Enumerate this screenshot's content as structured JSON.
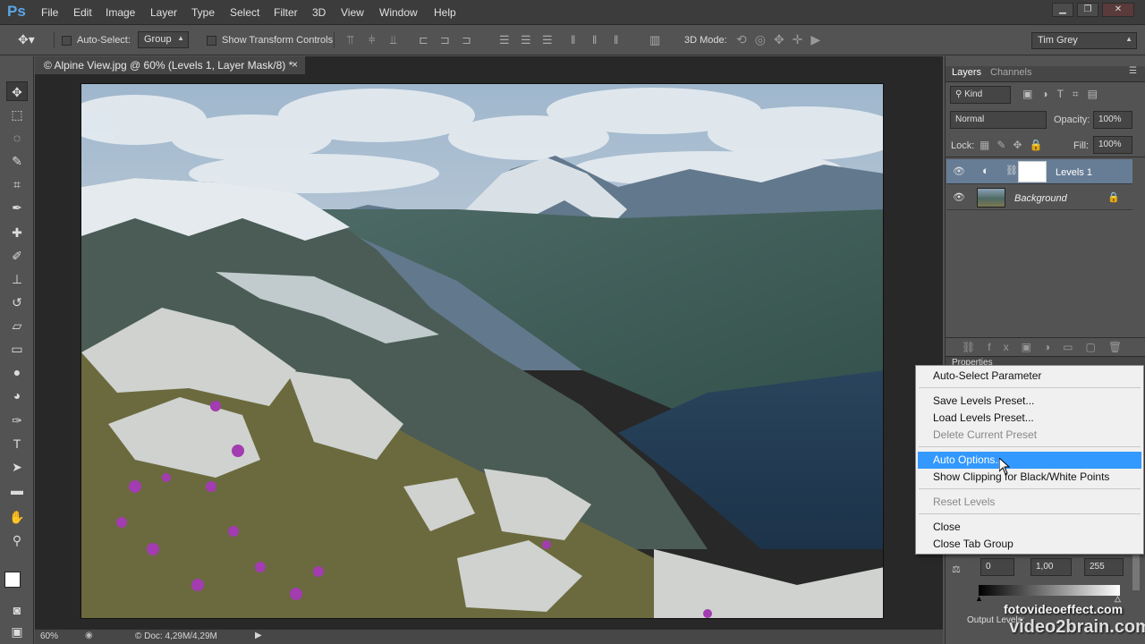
{
  "app": {
    "logo": "Ps"
  },
  "menubar": {
    "items": [
      "File",
      "Edit",
      "Image",
      "Layer",
      "Type",
      "Select",
      "Filter",
      "3D",
      "View",
      "Window",
      "Help"
    ]
  },
  "window_controls": {
    "minimize": "▁",
    "restore": "❐",
    "close": "✕"
  },
  "options_bar": {
    "auto_select_label": "Auto-Select:",
    "auto_select_value": "Group",
    "show_transform_label": "Show Transform Controls",
    "mode_3d_label": "3D Mode:",
    "workspace_value": "Tim Grey"
  },
  "document": {
    "tab_title": "© Alpine View.jpg @ 60% (Levels 1, Layer Mask/8) *",
    "tab_close": "×"
  },
  "status_bar": {
    "zoom": "60%",
    "doc_info": "© Doc: 4,29M/4,29M"
  },
  "layers_panel": {
    "tabs": [
      "Layers",
      "Channels"
    ],
    "filter_kind": "Kind",
    "blend_mode": "Normal",
    "opacity_label": "Opacity:",
    "opacity_value": "100%",
    "lock_label": "Lock:",
    "fill_label": "Fill:",
    "fill_value": "100%",
    "layers": [
      {
        "name": "Levels 1",
        "selected": true
      },
      {
        "name": "Background",
        "selected": false
      }
    ]
  },
  "properties_panel": {
    "tab": "Properties",
    "input_black": "0",
    "input_gamma": "1,00",
    "input_white": "255",
    "output_label": "Output Levels:"
  },
  "context_menu": {
    "items": [
      {
        "label": "Auto-Select Parameter",
        "state": "normal"
      },
      {
        "label": "Save Levels Preset...",
        "state": "normal"
      },
      {
        "label": "Load Levels Preset...",
        "state": "normal"
      },
      {
        "label": "Delete Current Preset",
        "state": "disabled"
      },
      {
        "label": "Auto Options...",
        "state": "highlighted"
      },
      {
        "label": "Show Clipping for Black/White Points",
        "state": "normal"
      },
      {
        "label": "Reset Levels",
        "state": "disabled"
      },
      {
        "label": "Close",
        "state": "normal"
      },
      {
        "label": "Close Tab Group",
        "state": "normal"
      }
    ]
  },
  "watermark": {
    "line1": "fotovideoeffect.com",
    "line2": "video2brain.com"
  },
  "colors": {
    "accent": "#3399ff",
    "ps_logo": "#5aa6e6",
    "panel_bg": "#535353",
    "menubar_bg": "#3c3c3c"
  }
}
